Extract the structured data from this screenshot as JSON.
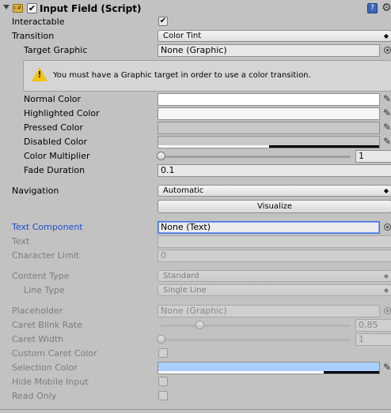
{
  "header": {
    "title": "Input Field (Script)",
    "enabled": true,
    "script_icon": "script-icon",
    "help_icon": "help-icon",
    "gear_icon": "gear-icon"
  },
  "interactable": {
    "label": "Interactable",
    "checked": true
  },
  "transition": {
    "label": "Transition",
    "value": "Color Tint"
  },
  "target_graphic": {
    "label": "Target Graphic",
    "value": "None (Graphic)"
  },
  "warning": {
    "text": "You must have a Graphic target in order to use a color transition."
  },
  "colors": {
    "normal": {
      "label": "Normal Color",
      "color": "#ffffff",
      "alpha": 1.0
    },
    "highlighted": {
      "label": "Highlighted Color",
      "color": "#f5f5f5",
      "alpha": 1.0
    },
    "pressed": {
      "label": "Pressed Color",
      "color": "#c8c8c8",
      "alpha": 1.0
    },
    "disabled": {
      "label": "Disabled Color",
      "color": "#c8c8c8",
      "alpha": 0.5
    }
  },
  "color_multiplier": {
    "label": "Color Multiplier",
    "value": "1",
    "fraction": 0.0
  },
  "fade_duration": {
    "label": "Fade Duration",
    "value": "0.1"
  },
  "navigation": {
    "label": "Navigation",
    "value": "Automatic",
    "visualize": "Visualize"
  },
  "text_component": {
    "label": "Text Component",
    "value": "None (Text)"
  },
  "text": {
    "label": "Text",
    "value": ""
  },
  "character_limit": {
    "label": "Character Limit",
    "value": "0"
  },
  "content_type": {
    "label": "Content Type",
    "value": "Standard"
  },
  "line_type": {
    "label": "Line Type",
    "value": "Single Line"
  },
  "placeholder": {
    "label": "Placeholder",
    "value": "None (Graphic)"
  },
  "caret_blink_rate": {
    "label": "Caret Blink Rate",
    "value": "0.85",
    "fraction": 0.2
  },
  "caret_width": {
    "label": "Caret Width",
    "value": "1",
    "fraction": 0.0
  },
  "custom_caret_color": {
    "label": "Custom Caret Color",
    "checked": false
  },
  "selection_color": {
    "label": "Selection Color",
    "color": "#a8cefe",
    "alpha": 0.75
  },
  "hide_mobile_input": {
    "label": "Hide Mobile Input",
    "checked": false
  },
  "read_only": {
    "label": "Read Only",
    "checked": false
  },
  "accent": {
    "label_focus": "#1a4fd1",
    "warning": "#f1c40f"
  }
}
